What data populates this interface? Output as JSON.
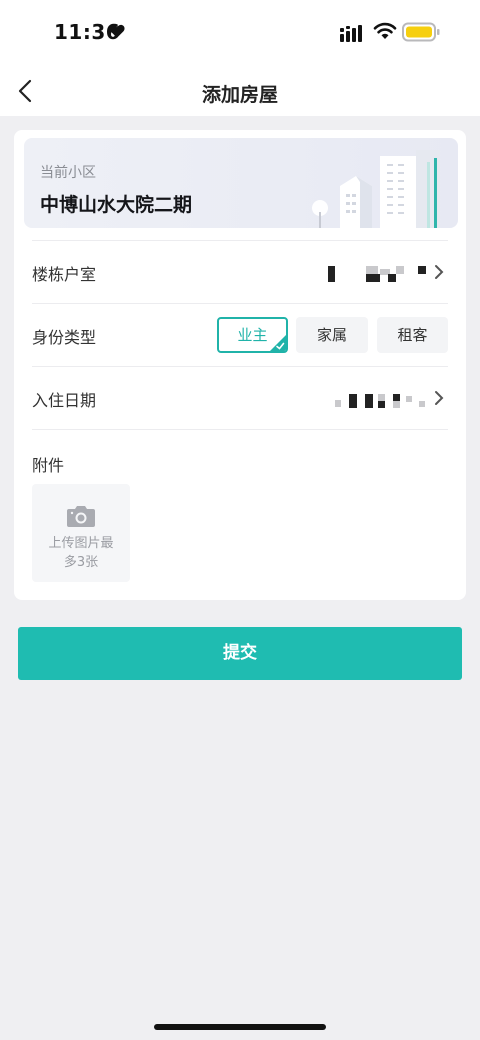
{
  "status_bar": {
    "time": "11:36"
  },
  "header": {
    "title": "添加房屋"
  },
  "community": {
    "label": "当前小区",
    "name": "中博山水大院二期"
  },
  "form": {
    "building_label": "楼栋户室",
    "identity_label": "身份类型",
    "identity_options": [
      "业主",
      "家属",
      "租客"
    ],
    "identity_selected": "业主",
    "date_label": "入住日期",
    "attachment_label": "附件",
    "upload_hint_line1": "上传图片最",
    "upload_hint_line2": "多3张"
  },
  "submit_label": "提交",
  "colors": {
    "accent": "#1fbcb1",
    "background": "#efeff2"
  },
  "icons": [
    "back-chevron-icon",
    "heart-icon",
    "signal-icon",
    "wifi-icon",
    "battery-icon",
    "chevron-right-icon",
    "camera-icon",
    "check-icon"
  ]
}
